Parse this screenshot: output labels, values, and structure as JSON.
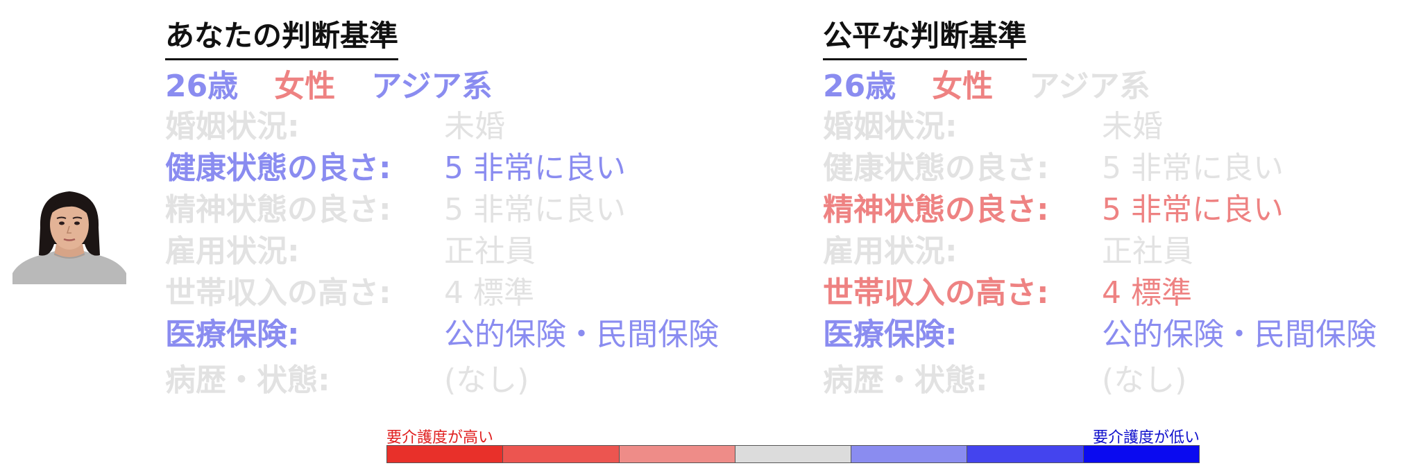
{
  "left": {
    "title": "あなたの判断基準",
    "demographics": [
      {
        "text": "26歳",
        "state": "blue"
      },
      {
        "text": "女性",
        "state": "red"
      },
      {
        "text": "アジア系",
        "state": "blue"
      }
    ],
    "attributes": [
      {
        "label": "婚姻状況:",
        "value": "未婚",
        "state": "gray"
      },
      {
        "label": "健康状態の良さ:",
        "value": "5 非常に良い",
        "state": "blue"
      },
      {
        "label": "精神状態の良さ:",
        "value": "5 非常に良い",
        "state": "gray"
      },
      {
        "label": "雇用状況:",
        "value": "正社員",
        "state": "gray"
      },
      {
        "label": "世帯収入の高さ:",
        "value": "4 標準",
        "state": "gray"
      },
      {
        "label": "医療保険:",
        "value": "公的保険・民間保険",
        "state": "blue"
      },
      {
        "label": "病歴・状態:",
        "value": "(なし)",
        "state": "gray"
      }
    ]
  },
  "right": {
    "title": "公平な判断基準",
    "demographics": [
      {
        "text": "26歳",
        "state": "blue"
      },
      {
        "text": "女性",
        "state": "red"
      },
      {
        "text": "アジア系",
        "state": "gray"
      }
    ],
    "attributes": [
      {
        "label": "婚姻状況:",
        "value": "未婚",
        "state": "gray"
      },
      {
        "label": "健康状態の良さ:",
        "value": "5 非常に良い",
        "state": "gray"
      },
      {
        "label": "精神状態の良さ:",
        "value": "5 非常に良い",
        "state": "red"
      },
      {
        "label": "雇用状況:",
        "value": "正社員",
        "state": "gray"
      },
      {
        "label": "世帯収入の高さ:",
        "value": "4 標準",
        "state": "red"
      },
      {
        "label": "医療保険:",
        "value": "公的保険・民間保険",
        "state": "blue"
      },
      {
        "label": "病歴・状態:",
        "value": "(なし)",
        "state": "gray"
      }
    ]
  },
  "state_colors": {
    "blue": "#8a8cf0",
    "red": "#ee8282",
    "gray": "#e2e2e2"
  },
  "legend": {
    "high_label": "要介護度が高い",
    "low_label": "要介護度が低い",
    "scale_colors": [
      "#e8302a",
      "#ec5550",
      "#ee8c88",
      "#dcdcdc",
      "#8a8cf0",
      "#4444ee",
      "#0a0af0"
    ]
  }
}
